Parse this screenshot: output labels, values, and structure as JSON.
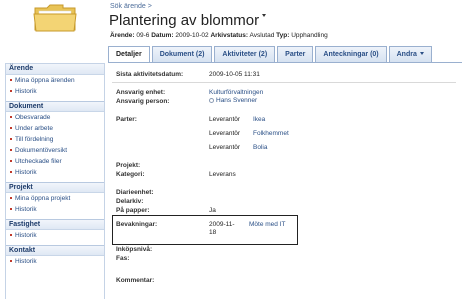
{
  "header": {
    "breadcrumb": "Sök ärende >",
    "title": "Plantering av blommor",
    "meta": {
      "arende_label": "Ärende:",
      "arende_value": "09-6",
      "datum_label": "Datum:",
      "datum_value": "2009-10-02",
      "arkivstatus_label": "Arkivstatus:",
      "arkivstatus_value": "Avslutad",
      "typ_label": "Typ:",
      "typ_value": "Upphandling"
    }
  },
  "tabs": [
    {
      "label": "Detaljer"
    },
    {
      "label": "Dokument (2)"
    },
    {
      "label": "Aktiviteter (2)"
    },
    {
      "label": "Parter"
    },
    {
      "label": "Anteckningar (0)"
    },
    {
      "label": "Andra"
    }
  ],
  "sidebar": {
    "sections": [
      {
        "title": "Ärende",
        "items": [
          "Mina öppna ärenden",
          "Historik"
        ]
      },
      {
        "title": "Dokument",
        "items": [
          "Obesvarade",
          "Under arbete",
          "Till fördelning",
          "Dokumentöversikt",
          "Utcheckade filer",
          "Historik"
        ]
      },
      {
        "title": "Projekt",
        "items": [
          "Mina öppna projekt",
          "Historik"
        ]
      },
      {
        "title": "Fastighet",
        "items": [
          "Historik"
        ]
      },
      {
        "title": "Kontakt",
        "items": [
          "Historik"
        ]
      }
    ]
  },
  "details": {
    "senaste_aktivitet_label": "Sista aktivitetsdatum:",
    "senaste_aktivitet_value": "2009-10-05 11:31",
    "ansvarig_enhet_label": "Ansvarig enhet:",
    "ansvarig_enhet_value": "Kulturförvaltningen",
    "ansvarig_person_label": "Ansvarig person:",
    "ansvarig_person_value": "Hans Svenner",
    "parter_label": "Parter:",
    "parter": [
      {
        "role": "Leverantör",
        "name": "Ikea"
      },
      {
        "role": "Leverantör",
        "name": "Folkhemmet"
      },
      {
        "role": "Leverantör",
        "name": "Bolia"
      }
    ],
    "projekt_label": "Projekt:",
    "kategori_label": "Kategori:",
    "kategori_value": "Leverans",
    "diarieenhet_label": "Diarieenhet:",
    "delarkiv_label": "Delarkiv:",
    "pa_papper_label": "På papper:",
    "pa_papper_value": "Ja",
    "bevakningar_label": "Bevakningar:",
    "bevakning_date_1": "2009-11-",
    "bevakning_date_2": "18",
    "bevakning_link": "Möte med IT",
    "inkopsniva_label": "Inköpsnivå:",
    "fas_label": "Fas:",
    "kommentar_label": "Kommentar:"
  }
}
